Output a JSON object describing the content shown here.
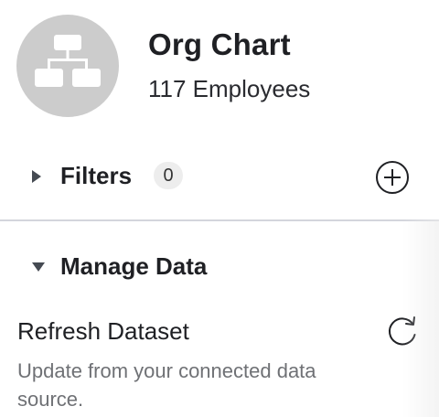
{
  "header": {
    "title": "Org Chart",
    "subtitle": "117 Employees",
    "avatar_icon": "org-chart-icon",
    "avatar_color": "#cccccc"
  },
  "filters": {
    "label": "Filters",
    "count": "0",
    "expanded": false,
    "add_icon": "plus-circle-icon"
  },
  "manage_data": {
    "label": "Manage Data",
    "expanded": true,
    "refresh": {
      "title": "Refresh Dataset",
      "description": "Update from your connected data source.",
      "icon": "refresh-icon"
    }
  },
  "colors": {
    "text_primary": "#1f2024",
    "text_secondary": "#6f7175",
    "divider": "#d3d5dc",
    "badge_bg": "#ededed"
  }
}
